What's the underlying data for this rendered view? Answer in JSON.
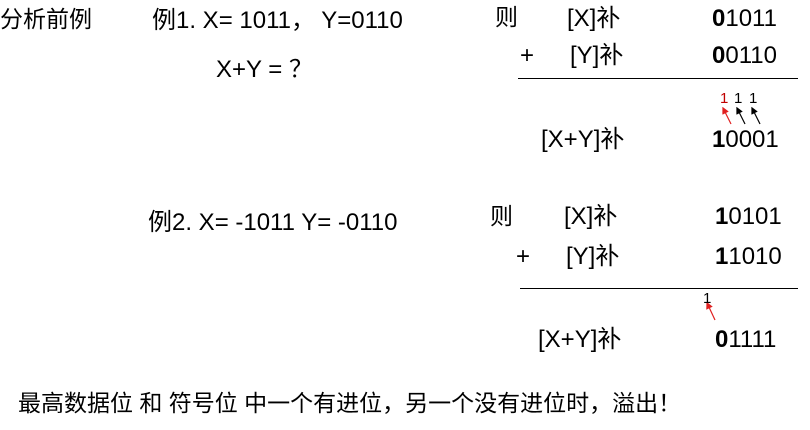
{
  "header": {
    "section_label": "分析前例"
  },
  "example1": {
    "label": "例1.  X= 1011，   Y=0110",
    "question": "X+Y = ？",
    "ze": "则",
    "row_x_label": "[X]补",
    "row_x_lead": "0",
    "row_x_rest": "1011",
    "plus": "+",
    "row_y_label": "[Y]补",
    "row_y_lead": "0",
    "row_y_rest": "0110",
    "carries": [
      "1",
      "1",
      "1"
    ],
    "result_label": "[X+Y]补",
    "result_lead": "1",
    "result_rest": "0001"
  },
  "example2": {
    "label": "例2.  X= -1011  Y= -0110",
    "ze": "则",
    "row_x_label": "[X]补",
    "row_x_lead": "1",
    "row_x_rest": "0101",
    "plus": "+",
    "row_y_label": "[Y]补",
    "row_y_lead": "1",
    "row_y_rest": "1010",
    "carry": "1",
    "result_label": "[X+Y]补",
    "result_lead": "0",
    "result_rest": "1111"
  },
  "conclusion": "最高数据位 和 符号位 中一个有进位，另一个没有进位时，溢出！",
  "colors": {
    "text": "#000000",
    "carry_red": "#c00000",
    "arrow_red": "#e02020"
  }
}
